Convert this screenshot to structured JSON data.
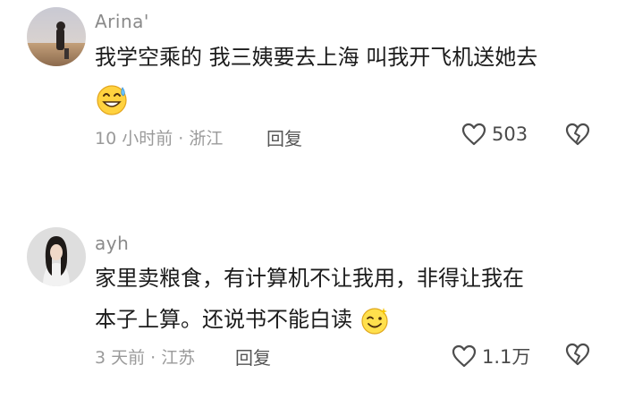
{
  "comments": [
    {
      "username": "Arina'",
      "text_line1": "我学空乘的 我三姨要去上海 叫我开飞机送她去",
      "text_line2": "",
      "emoji": "sweat-smile-emoji",
      "meta": "10 小时前 · 浙江",
      "reply_label": "回复",
      "like_count": "503",
      "avatar_colors": {
        "sky": "#cfcdd2",
        "ground": "#a98a6a"
      }
    },
    {
      "username": "ayh",
      "text_line1": "家里卖粮食，有计算机不让我用，非得让我在",
      "text_line2": "本子上算。还说书不能白读",
      "emoji": "cheeky-smile-emoji",
      "meta": "3 天前 · 江苏",
      "reply_label": "回复",
      "like_count": "1.1万",
      "avatar_colors": {
        "background": "#dcdcdc",
        "hair": "#1e1a18"
      }
    }
  ],
  "icons": {
    "like": "heart-outline-icon",
    "dislike": "broken-heart-icon"
  }
}
